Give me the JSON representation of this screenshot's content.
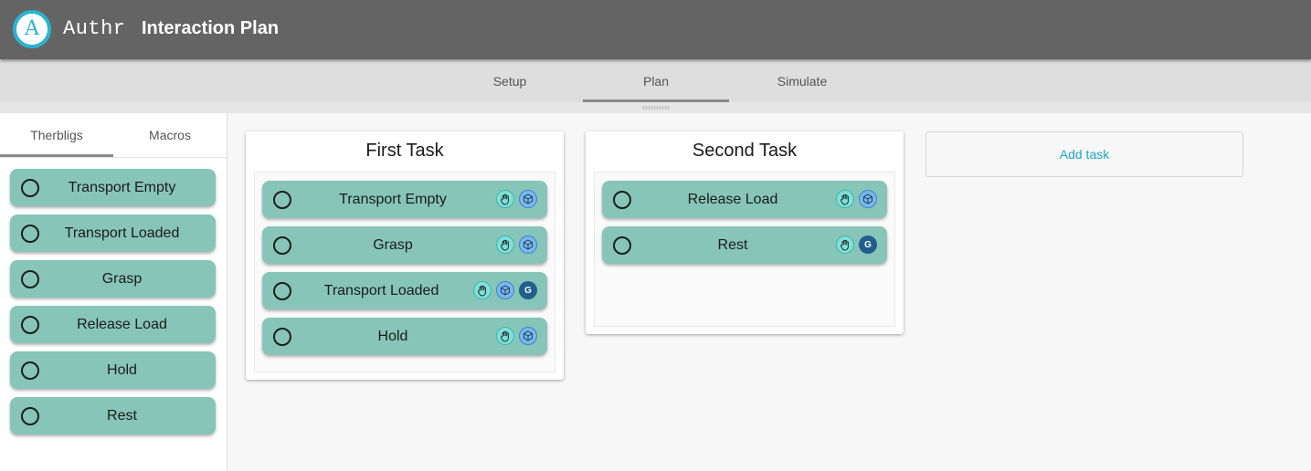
{
  "header": {
    "brand": "Authr",
    "title": "Interaction Plan",
    "logo_letter": "A"
  },
  "main_tabs": [
    {
      "label": "Setup"
    },
    {
      "label": "Plan"
    },
    {
      "label": "Simulate"
    }
  ],
  "active_main_tab": "Plan",
  "sidebar": {
    "tabs": [
      {
        "label": "Therbligs"
      },
      {
        "label": "Macros"
      }
    ],
    "active_tab": "Therbligs",
    "items": [
      {
        "label": "Transport Empty"
      },
      {
        "label": "Transport Loaded"
      },
      {
        "label": "Grasp"
      },
      {
        "label": "Release Load"
      },
      {
        "label": "Hold"
      },
      {
        "label": "Rest"
      }
    ]
  },
  "tasks": [
    {
      "title": "First Task",
      "items": [
        {
          "label": "Transport Empty",
          "icons": [
            "hand-icon",
            "cube-icon"
          ]
        },
        {
          "label": "Grasp",
          "icons": [
            "hand-icon",
            "cube-icon"
          ]
        },
        {
          "label": "Transport Loaded",
          "icons": [
            "hand-icon",
            "cube-icon",
            "goal-icon"
          ]
        },
        {
          "label": "Hold",
          "icons": [
            "hand-icon",
            "cube-icon"
          ]
        }
      ]
    },
    {
      "title": "Second Task",
      "items": [
        {
          "label": "Release Load",
          "icons": [
            "hand-icon",
            "cube-icon"
          ]
        },
        {
          "label": "Rest",
          "icons": [
            "hand-icon",
            "goal-icon"
          ]
        }
      ]
    }
  ],
  "goal_badge_letter": "G",
  "add_task_label": "Add task",
  "colors": {
    "header": "#646464",
    "accent": "#2bb4cf",
    "pill": "#87c5b9",
    "link": "#1ea6c7"
  }
}
